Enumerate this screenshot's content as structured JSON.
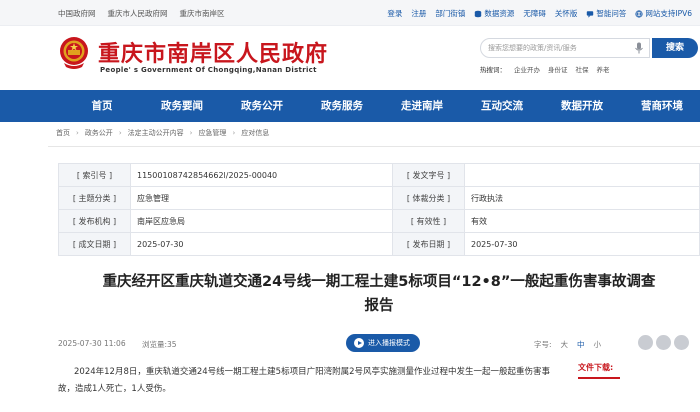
{
  "topbar": {
    "left_links": [
      "中国政府网",
      "重庆市人民政府网",
      "重庆市南岸区"
    ],
    "right_links": [
      "登录",
      "注册",
      "部门街镇",
      "数据资源",
      "无障碍",
      "关怀版",
      "智能问答"
    ],
    "ipv6": "网站支持IPV6"
  },
  "header": {
    "title": "重庆市南岸区人民政府",
    "subtitle": "People' s Government Of Chongqing,Nanan District",
    "search": {
      "placeholder": "搜索您想要的政策/资讯/服务",
      "button": "搜索"
    },
    "hot": {
      "label": "热搜词：",
      "items": [
        "企业开办",
        "身份证",
        "社保",
        "养老"
      ]
    }
  },
  "nav": [
    "首页",
    "政务要闻",
    "政务公开",
    "政务服务",
    "走进南岸",
    "互动交流",
    "数据开放",
    "营商环境"
  ],
  "breadcrumb": [
    "首页",
    "政务公开",
    "法定主动公开内容",
    "应急管理",
    "应对信息"
  ],
  "info": [
    {
      "k1": "[ 索引号 ]",
      "v1": "11500108742854662l/2025-00040",
      "k2": "[ 发文字号 ]",
      "v2": ""
    },
    {
      "k1": "[ 主题分类 ]",
      "v1": "应急管理",
      "k2": "[ 体裁分类 ]",
      "v2": "行政执法"
    },
    {
      "k1": "[ 发布机构 ]",
      "v1": "南岸区应急局",
      "k2": "[ 有效性 ]",
      "v2": "有效"
    },
    {
      "k1": "[ 成文日期 ]",
      "v1": "2025-07-30",
      "k2": "[ 发布日期 ]",
      "v2": "2025-07-30"
    }
  ],
  "article": {
    "title_line1": "重庆经开区重庆轨道交通24号线一期工程土建5标项目“12•8”一般起重伤害事故调查",
    "title_line2": "报告",
    "date": "2025-07-30 11:06",
    "views": "浏览量:35",
    "broadcast": "进入播报模式",
    "fontsize_label": "字号:",
    "fontsize_large": "大",
    "fontsize_medium": "中",
    "fontsize_small": "小",
    "body": "2024年12月8日，重庆轨道交通24号线一期工程土建5标项目广阳湾附属2号风亭实施测量作业过程中发生一起一般起重伤害事故，造成1人死亡，1人受伤。",
    "download": "文件下载:"
  },
  "colors": {
    "brand_red": "#c8161d",
    "nav_blue": "#1a5aa8"
  }
}
